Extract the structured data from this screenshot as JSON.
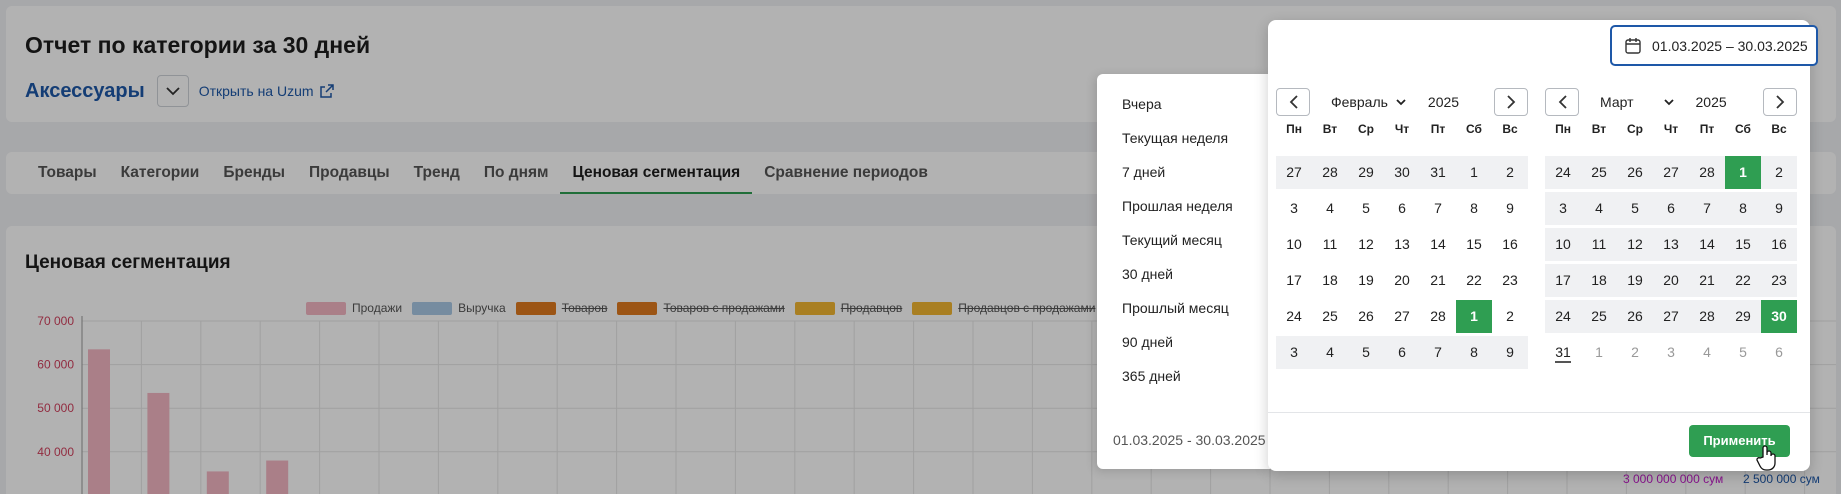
{
  "header": {
    "title": "Отчет по категории за 30 дней",
    "category": "Аксессуары",
    "open_link": "Открыть на Uzum"
  },
  "tabs": [
    {
      "label": "Товары"
    },
    {
      "label": "Категории"
    },
    {
      "label": "Бренды"
    },
    {
      "label": "Продавцы"
    },
    {
      "label": "Тренд"
    },
    {
      "label": "По дням"
    },
    {
      "label": "Ценовая сегментация",
      "active": true
    },
    {
      "label": "Сравнение периодов"
    }
  ],
  "section": {
    "title": "Ценовая сегментация",
    "legend": [
      {
        "label": "Продажи",
        "color": "#f4b7c3",
        "enabled": true
      },
      {
        "label": "Выручка",
        "color": "#a9c9e6",
        "enabled": true
      },
      {
        "label": "Товаров",
        "color": "#e07a1f",
        "enabled": false
      },
      {
        "label": "Товаров с продажами",
        "color": "#e07a1f",
        "enabled": false
      },
      {
        "label": "Продавцов",
        "color": "#f2b632",
        "enabled": false
      },
      {
        "label": "Продавцов с продажами",
        "color": "#f2b632",
        "enabled": false
      }
    ],
    "right_values": [
      "3 000 000 000 сум",
      "2 500 000 сум"
    ]
  },
  "chart_data": {
    "type": "bar",
    "y_ticks": [
      "70 000",
      "60 000",
      "50 000",
      "40 000"
    ],
    "ylim": [
      30000,
      70000
    ],
    "series": [
      {
        "name": "Продажи",
        "values": [
          63500,
          53500,
          35500,
          38000
        ]
      }
    ]
  },
  "date_picker": {
    "range_value": "01.03.2025 – 30.03.2025",
    "presets": [
      "Вчера",
      "Текущая неделя",
      "7 дней",
      "Прошлая неделя",
      "Текущий месяц",
      "30 дней",
      "Прошлый месяц",
      "90 дней",
      "365 дней"
    ],
    "preset_range": "01.03.2025 - 30.03.2025",
    "weekdays": [
      "Пн",
      "Вт",
      "Ср",
      "Чт",
      "Пт",
      "Сб",
      "Вс"
    ],
    "left": {
      "month": "Февраль",
      "year": "2025",
      "weeks": [
        [
          "27",
          "28",
          "29",
          "30",
          "31",
          "1",
          "2"
        ],
        [
          "3",
          "4",
          "5",
          "6",
          "7",
          "8",
          "9"
        ],
        [
          "10",
          "11",
          "12",
          "13",
          "14",
          "15",
          "16"
        ],
        [
          "17",
          "18",
          "19",
          "20",
          "21",
          "22",
          "23"
        ],
        [
          "24",
          "25",
          "26",
          "27",
          "28",
          "1",
          "2"
        ],
        [
          "3",
          "4",
          "5",
          "6",
          "7",
          "8",
          "9"
        ]
      ],
      "shaded_rows": [
        0,
        5
      ],
      "selected": [
        [
          4,
          5
        ]
      ]
    },
    "right": {
      "month": "Март",
      "year": "2025",
      "weeks": [
        [
          "24",
          "25",
          "26",
          "27",
          "28",
          "1",
          "2"
        ],
        [
          "3",
          "4",
          "5",
          "6",
          "7",
          "8",
          "9"
        ],
        [
          "10",
          "11",
          "12",
          "13",
          "14",
          "15",
          "16"
        ],
        [
          "17",
          "18",
          "19",
          "20",
          "21",
          "22",
          "23"
        ],
        [
          "24",
          "25",
          "26",
          "27",
          "28",
          "29",
          "30"
        ],
        [
          "31",
          "1",
          "2",
          "3",
          "4",
          "5",
          "6"
        ]
      ],
      "shaded_rows": [
        0,
        1,
        2,
        3,
        4
      ],
      "muted": [
        [
          5,
          1
        ],
        [
          5,
          2
        ],
        [
          5,
          3
        ],
        [
          5,
          4
        ],
        [
          5,
          5
        ],
        [
          5,
          6
        ]
      ],
      "today": [
        5,
        0
      ],
      "selected": [
        [
          0,
          5
        ],
        [
          4,
          6
        ]
      ]
    },
    "apply_label": "Применить"
  }
}
